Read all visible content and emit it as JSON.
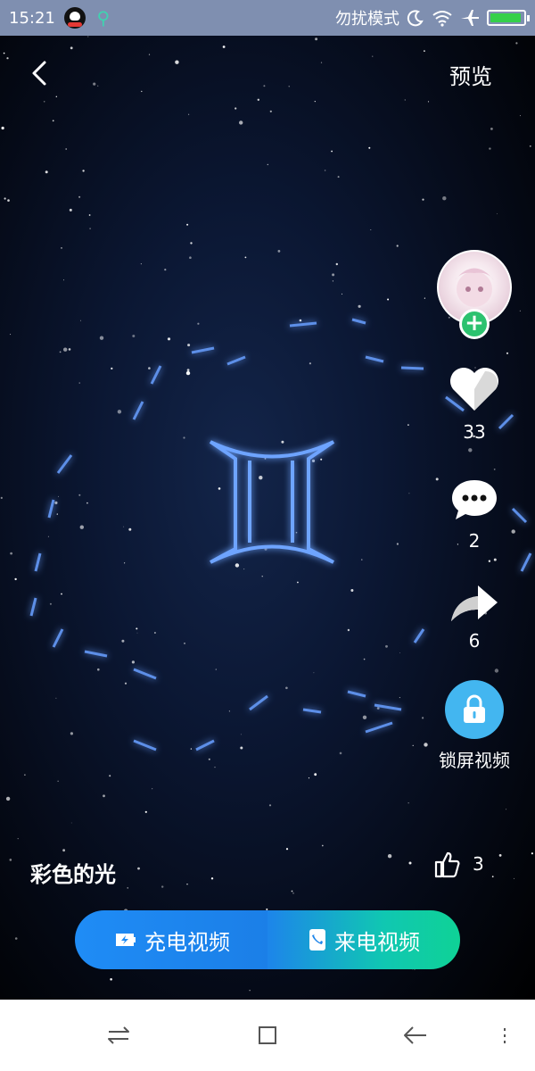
{
  "status_bar": {
    "time": "15:21",
    "mode": "勿扰模式",
    "icons": [
      "qq-icon",
      "usb-icon",
      "moon-icon",
      "wifi-icon",
      "airplane-icon",
      "battery-icon"
    ],
    "battery_level": 0.95
  },
  "header": {
    "preview_label": "预览"
  },
  "actions": {
    "likes": "33",
    "comments": "2",
    "shares": "6",
    "lock_label": "锁屏视频"
  },
  "video": {
    "title": "彩色的光",
    "thumbs_count": "3"
  },
  "buttons": {
    "charge_label": "充电视频",
    "call_label": "来电视频"
  },
  "colors": {
    "status_bar": "#7f8fb0",
    "accent_green": "#2cc26f",
    "lock_blue": "#43b6f0",
    "charge_blue": "#1f8cf6",
    "call_teal": "#0fd296"
  }
}
